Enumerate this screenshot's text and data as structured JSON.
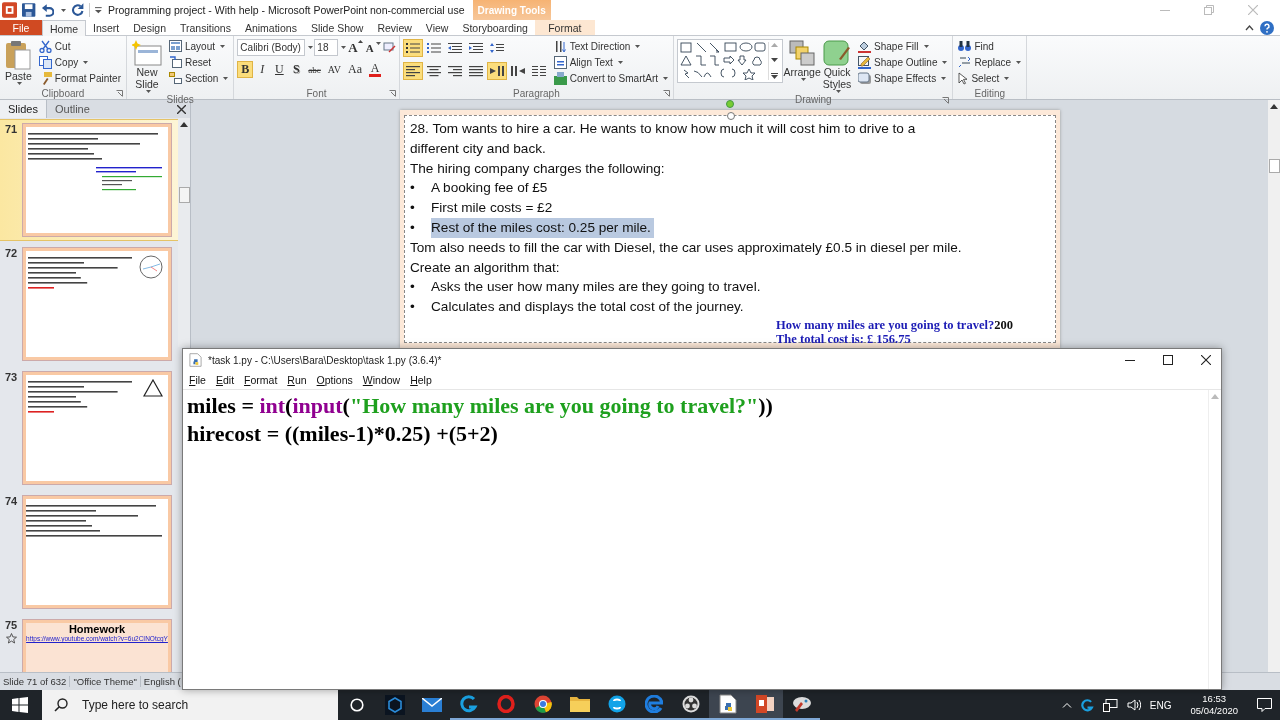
{
  "title_bar": {
    "title": "Programming project - With help  -  Microsoft PowerPoint non-commercial use",
    "contextual_group": "Drawing Tools"
  },
  "ribbon_tabs": [
    {
      "label": "File",
      "kind": "file",
      "selected": false
    },
    {
      "label": "Home",
      "kind": "normal",
      "selected": true
    },
    {
      "label": "Insert",
      "kind": "normal",
      "selected": false
    },
    {
      "label": "Design",
      "kind": "normal",
      "selected": false
    },
    {
      "label": "Transitions",
      "kind": "normal",
      "selected": false
    },
    {
      "label": "Animations",
      "kind": "normal",
      "selected": false
    },
    {
      "label": "Slide Show",
      "kind": "normal",
      "selected": false
    },
    {
      "label": "Review",
      "kind": "normal",
      "selected": false
    },
    {
      "label": "View",
      "kind": "normal",
      "selected": false
    },
    {
      "label": "Storyboarding",
      "kind": "normal",
      "selected": false
    },
    {
      "label": "Format",
      "kind": "contextual",
      "selected": false
    }
  ],
  "clipboard": {
    "label": "Clipboard",
    "paste": "Paste",
    "cut": "Cut",
    "copy": "Copy",
    "format_painter": "Format Painter"
  },
  "slides_group": {
    "label": "Slides",
    "new_slide": "New Slide",
    "layout": "Layout",
    "reset": "Reset",
    "section": "Section"
  },
  "font": {
    "label": "Font",
    "font_name": "Calibri (Body)",
    "font_size": "18",
    "grow": "A",
    "shrink": "A",
    "styles": [
      {
        "label": "B",
        "kind": "bold",
        "selected": true
      },
      {
        "label": "I",
        "kind": "italic",
        "selected": false
      },
      {
        "label": "U",
        "kind": "underline",
        "selected": false
      },
      {
        "label": "S",
        "kind": "shadow",
        "selected": false
      },
      {
        "label": "abc",
        "kind": "strike",
        "selected": false
      },
      {
        "label": "AV",
        "kind": "spacing",
        "selected": false
      },
      {
        "label": "Aa",
        "kind": "case",
        "selected": false
      },
      {
        "label": "A",
        "kind": "color",
        "selected": false
      }
    ]
  },
  "paragraph": {
    "label": "Paragraph",
    "top_buttons": [
      {
        "kind": "bullets",
        "selected": true
      },
      {
        "kind": "numbering",
        "selected": false
      },
      {
        "kind": "outdent",
        "selected": false
      },
      {
        "kind": "indent",
        "selected": false
      },
      {
        "kind": "spacing",
        "selected": false
      }
    ],
    "bottom_buttons": [
      {
        "kind": "left",
        "selected": true
      },
      {
        "kind": "center",
        "selected": false
      },
      {
        "kind": "right",
        "selected": false
      },
      {
        "kind": "justify",
        "selected": false
      },
      {
        "kind": "ltr",
        "selected": true
      },
      {
        "kind": "rtl",
        "selected": false
      },
      {
        "kind": "columns",
        "selected": false
      }
    ],
    "text_direction": "Text Direction",
    "align_text": "Align Text",
    "convert": "Convert to SmartArt"
  },
  "drawing": {
    "label": "Drawing",
    "arrange": "Arrange",
    "quick_styles": "Quick Styles",
    "shape_fill": "Shape Fill",
    "shape_outline": "Shape Outline",
    "shape_effects": "Shape Effects"
  },
  "editing": {
    "label": "Editing",
    "find": "Find",
    "replace": "Replace",
    "select": "Select"
  },
  "panel_tabs": [
    {
      "label": "Slides",
      "selected": true
    },
    {
      "label": "Outline",
      "selected": false
    }
  ],
  "thumbnails": [
    {
      "number": "71",
      "kind": "output",
      "selected": true
    },
    {
      "number": "72",
      "kind": "circle",
      "selected": false
    },
    {
      "number": "73",
      "kind": "triangle",
      "selected": false
    },
    {
      "number": "74",
      "kind": "text",
      "selected": false
    },
    {
      "number": "75",
      "kind": "title",
      "selected": false,
      "title": "Homework",
      "link": "https://www.youtube.com/watch?v=6u2CINOtcgY"
    }
  ],
  "slide": {
    "paragraphs": [
      {
        "kind": "text",
        "text": "28. Tom wants to hire a car. He wants to know how much it will cost him to drive to a different city and back."
      },
      {
        "kind": "text",
        "text": "The hiring company charges the following:"
      },
      {
        "kind": "bullet",
        "marker": "•",
        "text": "A booking fee of £5",
        "highlighted": false
      },
      {
        "kind": "bullet",
        "marker": "•",
        "text": "First mile costs = £2",
        "highlighted": false
      },
      {
        "kind": "bullet",
        "marker": "•",
        "text": "Rest of the miles cost: 0.25 per mile.",
        "highlighted": true
      },
      {
        "kind": "text",
        "text": "Tom also needs to fill the car with Diesel, the car uses approximately £0.5 in diesel per mile."
      },
      {
        "kind": "text",
        "text": "Create an algorithm that:"
      },
      {
        "kind": "bullet",
        "marker": "•",
        "text": "Asks the user how many miles are they going to travel.",
        "highlighted": false
      },
      {
        "kind": "bullet",
        "marker": "•",
        "text": "Calculates and displays the total cost of the journey.",
        "highlighted": false
      }
    ],
    "output": [
      {
        "text": "How many miles are you going to travel?",
        "input": "200"
      },
      {
        "text": "The total cost is: £ 156.75"
      }
    ]
  },
  "status_bar": [
    "Slide 71 of 632",
    "\"Office Theme\"",
    "English ("
  ],
  "editor": {
    "title": "*task 1.py - C:\\Users\\Bara\\Desktop\\task 1.py (3.6.4)*",
    "menus": [
      "File",
      "Edit",
      "Format",
      "Run",
      "Options",
      "Window",
      "Help"
    ],
    "lines": [
      [
        {
          "text": "miles = ",
          "kind": "plain"
        },
        {
          "text": "int",
          "kind": "builtin"
        },
        {
          "text": "(",
          "kind": "plain"
        },
        {
          "text": "input",
          "kind": "builtin"
        },
        {
          "text": "(",
          "kind": "plain"
        },
        {
          "text": "\"How many miles are you going to travel?\"",
          "kind": "string"
        },
        {
          "text": "))",
          "kind": "plain"
        }
      ],
      [
        {
          "text": "hirecost = ((miles-1)*0.25) +(5+2)",
          "kind": "plain"
        }
      ]
    ]
  },
  "taskbar": {
    "search_placeholder": "Type here to search",
    "apps": [
      {
        "kind": "cube",
        "running": false,
        "active": false
      },
      {
        "kind": "mail",
        "running": false,
        "active": false
      },
      {
        "kind": "hook",
        "running": true,
        "active": false
      },
      {
        "kind": "ring",
        "running": true,
        "active": false
      },
      {
        "kind": "wheel",
        "running": true,
        "active": false
      },
      {
        "kind": "folder",
        "running": true,
        "active": false
      },
      {
        "kind": "chat",
        "running": true,
        "active": false
      },
      {
        "kind": "globe",
        "running": true,
        "active": false
      },
      {
        "kind": "aperture",
        "running": true,
        "active": false
      },
      {
        "kind": "document",
        "running": true,
        "active": true
      },
      {
        "kind": "presentation",
        "running": true,
        "active": true
      },
      {
        "kind": "paint",
        "running": true,
        "active": false
      }
    ],
    "language": "ENG",
    "time": "16:53",
    "date": "05/04/2020"
  }
}
